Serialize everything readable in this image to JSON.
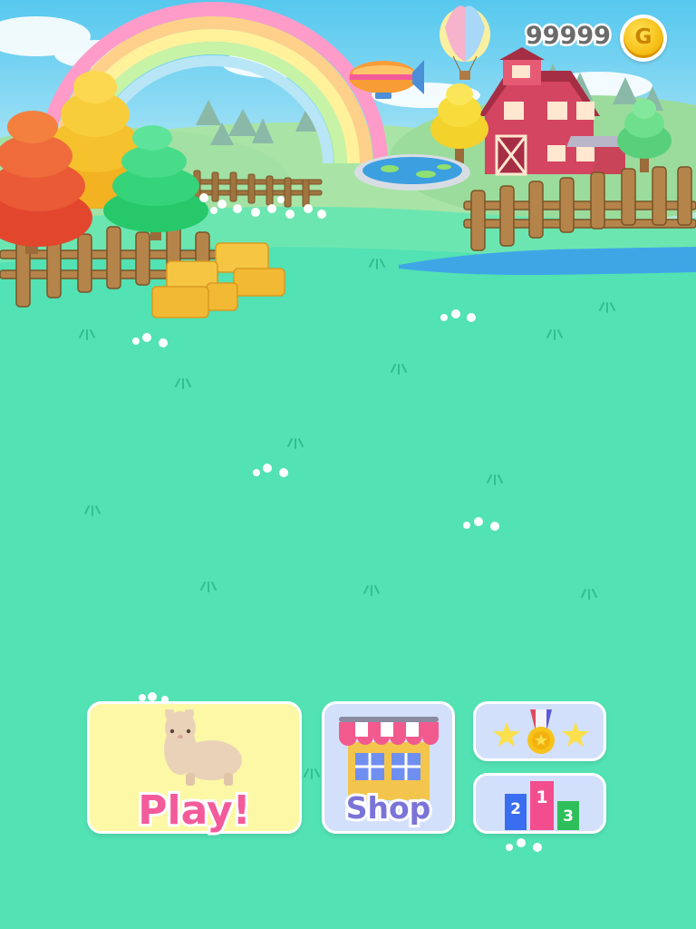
{
  "hud": {
    "coin_count": "99999",
    "coin_letter": "G"
  },
  "menu": {
    "play_label": "Play!",
    "shop_label": "Shop",
    "podium_labels": [
      "2",
      "1",
      "3"
    ]
  },
  "colors": {
    "play_button_bg": "#fcf8a6",
    "menu_button_bg": "#d3e0fb",
    "play_text": "#f35b9b",
    "shop_text": "#7b74d8",
    "grass": "#42dfb1"
  }
}
